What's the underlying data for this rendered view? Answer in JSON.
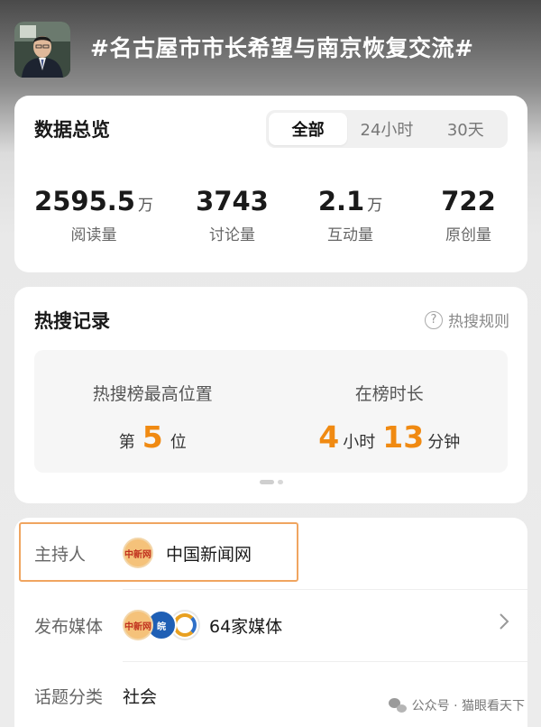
{
  "header": {
    "topic": "#名古屋市市长希望与南京恢复交流#"
  },
  "overview": {
    "title": "数据总览",
    "tabs": [
      {
        "label": "全部",
        "active": true
      },
      {
        "label": "24小时",
        "active": false
      },
      {
        "label": "30天",
        "active": false
      }
    ],
    "stats": [
      {
        "value": "2595.5",
        "unit": "万",
        "label": "阅读量"
      },
      {
        "value": "3743",
        "unit": "",
        "label": "讨论量"
      },
      {
        "value": "2.1",
        "unit": "万",
        "label": "互动量"
      },
      {
        "value": "722",
        "unit": "",
        "label": "原创量"
      }
    ]
  },
  "hot": {
    "title": "热搜记录",
    "rules_label": "热搜规则",
    "rules_icon": "?",
    "peak": {
      "label": "热搜榜最高位置",
      "prefix": "第",
      "value": "5",
      "suffix": "位"
    },
    "duration": {
      "label": "在榜时长",
      "hours": "4",
      "hours_unit": "小时",
      "minutes": "13",
      "minutes_unit": "分钟"
    }
  },
  "info": {
    "host": {
      "label": "主持人",
      "name": "中国新闻网",
      "logo_text": "中新网"
    },
    "media": {
      "label": "发布媒体",
      "value": "64家媒体",
      "logo1": "中新网",
      "logo2": "皖"
    },
    "category": {
      "label": "话题分类",
      "value": "社会"
    }
  },
  "watermark": {
    "text": "公众号 · 猫眼看天下"
  },
  "colors": {
    "accent": "#f08a12",
    "highlight_border": "#f0a560"
  }
}
